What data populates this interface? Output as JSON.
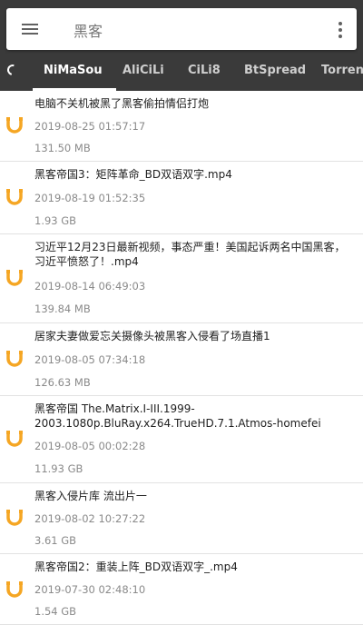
{
  "search": {
    "query": "黑客"
  },
  "tabs": [
    "NiMaSou",
    "AliCiLi",
    "CiLi8",
    "BtSpread",
    "Torrent"
  ],
  "colors": {
    "toolbar": "#3a3a3a",
    "icon_accent": "#f5a623"
  },
  "icons": {
    "menu": "hamburger-menu",
    "more": "vertical-dots",
    "refresh": "loading-spinner",
    "result": "magnet-u"
  },
  "results": [
    {
      "title": "电脑不关机被黑了黑客偷拍情侣打炮",
      "date": "2019-08-25 01:57:17",
      "size": "131.50 MB"
    },
    {
      "title": "黑客帝国3：矩阵革命_BD双语双字.mp4",
      "date": "2019-08-19 01:52:35",
      "size": "1.93 GB"
    },
    {
      "title": "习近平12月23日最新视频，事态严重！美国起诉两名中国黑客，习近平愤怒了！.mp4",
      "date": "2019-08-14 06:49:03",
      "size": "139.84 MB"
    },
    {
      "title": "居家夫妻做爱忘关摄像头被黑客入侵看了场直播1",
      "date": "2019-08-05 07:34:18",
      "size": "126.63 MB"
    },
    {
      "title": "黑客帝国 The.Matrix.I-III.1999-2003.1080p.BluRay.x264.TrueHD.7.1.Atmos-homefei",
      "date": "2019-08-05 00:02:28",
      "size": "11.93 GB"
    },
    {
      "title": "黑客入侵片库 流出片一",
      "date": "2019-08-02 10:27:22",
      "size": "3.61 GB"
    },
    {
      "title": "黑客帝国2：重装上阵_BD双语双字_.mp4",
      "date": "2019-07-30 02:48:10",
      "size": "1.54 GB"
    }
  ]
}
